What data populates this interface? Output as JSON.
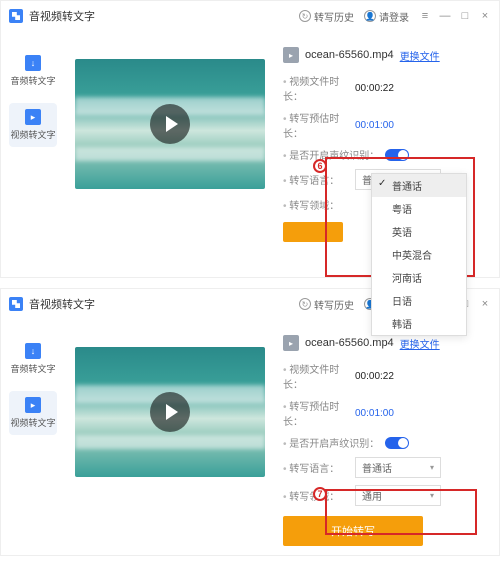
{
  "app_title": "音视频转文字",
  "header": {
    "history": "转写历史",
    "login": "请登录"
  },
  "sidebar": {
    "items": [
      {
        "label": "音频转文字"
      },
      {
        "label": "视频转文字"
      }
    ]
  },
  "file": {
    "name": "ocean-65560.mp4",
    "change_link": "更换文件"
  },
  "rows": {
    "src_duration_label": "视频文件时长：",
    "src_duration_value": "00:00:22",
    "est_duration_label": "转写预估时长：",
    "est_duration_value": "00:01:00",
    "voiceprint_label": "是否开启声纹识别：",
    "language_label": "转写语言：",
    "domain_label": "转写领域："
  },
  "selects": {
    "language_value": "普通话",
    "domain_value": "通用"
  },
  "dropdown_options": [
    "普通话",
    "粤语",
    "英语",
    "中英混合",
    "河南话",
    "日语",
    "韩语"
  ],
  "action_button": "开始转写",
  "badges": {
    "top": "6",
    "bottom": "7"
  }
}
